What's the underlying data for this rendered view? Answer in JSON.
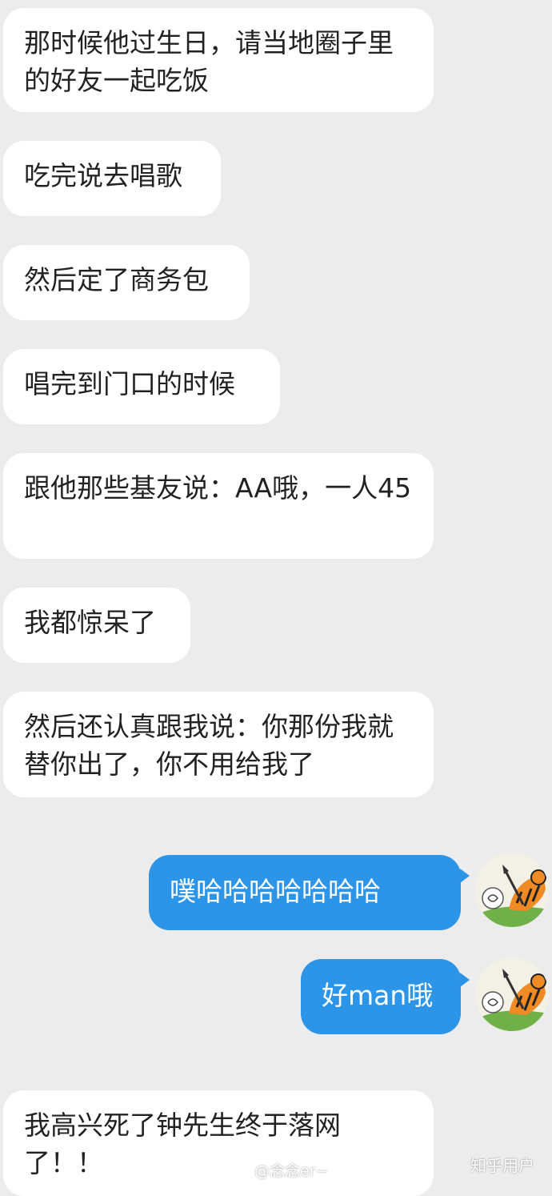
{
  "chat": {
    "incoming": [
      "那时候他过生日，请当地圈子里的好友一起吃饭",
      "吃完说去唱歌",
      "然后定了商务包",
      "唱完到门口的时候",
      "跟他那些基友说：AA哦，一人45",
      "我都惊呆了",
      "然后还认真跟我说：你那份我就替你出了，你不用给我了"
    ],
    "outgoing": [
      "噗哈哈哈哈哈哈哈",
      "好man哦"
    ],
    "last_incoming": "我高兴死了钟先生终于落网了！！"
  },
  "watermarks": {
    "weibo": "@念念er~",
    "zhihu": "知乎用户"
  },
  "colors": {
    "background": "#ececec",
    "incoming_bubble": "#ffffff",
    "outgoing_bubble": "#2d95e8"
  },
  "icons": {
    "avatar": "tiger-cartoon-avatar",
    "weibo": "weibo-logo-icon"
  }
}
